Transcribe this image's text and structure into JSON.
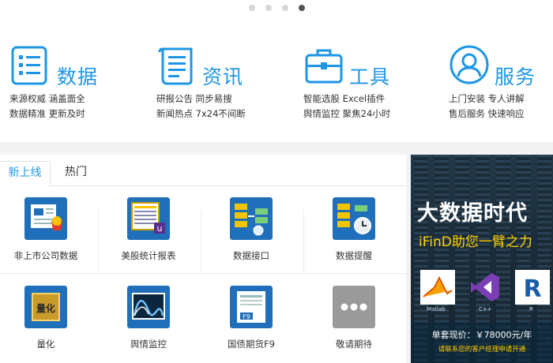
{
  "carousel": {
    "count": 4,
    "active_index": 3
  },
  "features": [
    {
      "icon": "list-document-icon",
      "title": "数据",
      "lines": [
        "来源权威  涵盖面全",
        "数据精准  更新及时"
      ]
    },
    {
      "icon": "newspaper-icon",
      "title": "资讯",
      "lines": [
        "研报公告  同步易搜",
        "新闻热点  7x24不间断"
      ]
    },
    {
      "icon": "toolbox-icon",
      "title": "工具",
      "lines": [
        "智能选股  Excel插件",
        "舆情监控  聚焦24小时"
      ]
    },
    {
      "icon": "user-service-icon",
      "title": "服务",
      "lines": [
        "上门安装  专人讲解",
        "售后服务  快速响应"
      ]
    }
  ],
  "tabs": [
    {
      "label": "新上线",
      "active": true
    },
    {
      "label": "热门",
      "active": false
    }
  ],
  "apps": [
    {
      "label": "非上市公司数据",
      "icon": "company-data-icon"
    },
    {
      "label": "美股统计报表",
      "icon": "us-stock-report-icon"
    },
    {
      "label": "数据接口",
      "icon": "data-interface-icon"
    },
    {
      "label": "数据提醒",
      "icon": "data-reminder-icon"
    },
    {
      "label": "量化",
      "icon": "quant-chip-icon",
      "icon_text": "量化"
    },
    {
      "label": "舆情监控",
      "icon": "sentiment-monitor-icon"
    },
    {
      "label": "国债期货F9",
      "icon": "bond-futures-icon",
      "icon_text": "F9"
    },
    {
      "label": "敬请期待",
      "icon": "more-dots-icon"
    }
  ],
  "banner": {
    "title": "大数据时代",
    "subtitle": "iFinD助您一臂之力",
    "logos": [
      {
        "icon": "matlab-logo-icon",
        "label": "Matlab"
      },
      {
        "icon": "cpp-logo-icon",
        "label": "C++"
      },
      {
        "icon": "r-logo-icon",
        "label": "R",
        "text": "R"
      }
    ],
    "price": "单套现价：￥78000元/年",
    "note": "请联系您的客户经理申请开通"
  },
  "colors": {
    "accent": "#1e96e6",
    "banner_highlight": "#ffd200"
  }
}
